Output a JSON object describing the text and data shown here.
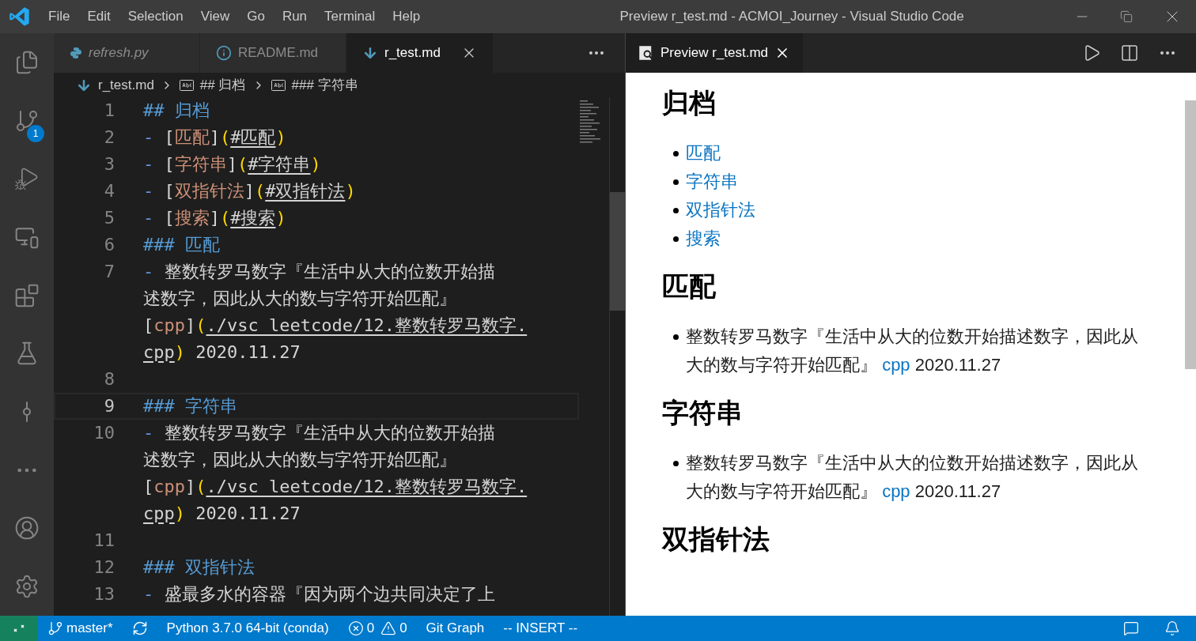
{
  "menu": [
    "File",
    "Edit",
    "Selection",
    "View",
    "Go",
    "Run",
    "Terminal",
    "Help"
  ],
  "window": {
    "title": "Preview r_test.md - ACMOI_Journey - Visual Studio Code"
  },
  "activity_bar": [
    {
      "kind": "files"
    },
    {
      "kind": "source-control",
      "badge": "1"
    },
    {
      "kind": "run"
    },
    {
      "kind": "remote"
    },
    {
      "kind": "extensions"
    },
    {
      "kind": "testing"
    },
    {
      "kind": "graph"
    },
    {
      "kind": "more"
    }
  ],
  "activity_bottom": [
    {
      "kind": "account"
    },
    {
      "kind": "settings"
    }
  ],
  "tabs": [
    {
      "label": "refresh.py",
      "preview": true,
      "selected": false
    },
    {
      "label": "README.md",
      "preview": false,
      "selected": false
    },
    {
      "label": "r_test.md",
      "preview": false,
      "selected": true
    }
  ],
  "breadcrumbs": [
    {
      "label": "r_test.md"
    },
    {
      "label": "## 归档"
    },
    {
      "label": "### 字符串"
    }
  ],
  "code_lines": [
    {
      "number": "1",
      "current": false,
      "tokens": [
        {
          "text": "## 归档",
          "kind": "heading"
        }
      ]
    },
    {
      "number": "2",
      "current": false,
      "tokens": [
        {
          "text": "- ",
          "kind": "bullet"
        },
        {
          "text": "[",
          "kind": "punct"
        },
        {
          "text": "匹配",
          "kind": "linktext"
        },
        {
          "text": "]",
          "kind": "punct"
        },
        {
          "text": "(",
          "kind": "paren"
        },
        {
          "text": "#匹配",
          "kind": "url"
        },
        {
          "text": ")",
          "kind": "paren"
        }
      ]
    },
    {
      "number": "3",
      "current": false,
      "tokens": [
        {
          "text": "- ",
          "kind": "bullet"
        },
        {
          "text": "[",
          "kind": "punct"
        },
        {
          "text": "字符串",
          "kind": "linktext"
        },
        {
          "text": "]",
          "kind": "punct"
        },
        {
          "text": "(",
          "kind": "paren"
        },
        {
          "text": "#字符串",
          "kind": "url"
        },
        {
          "text": ")",
          "kind": "paren"
        }
      ]
    },
    {
      "number": "4",
      "current": false,
      "tokens": [
        {
          "text": "- ",
          "kind": "bullet"
        },
        {
          "text": "[",
          "kind": "punct"
        },
        {
          "text": "双指针法",
          "kind": "linktext"
        },
        {
          "text": "]",
          "kind": "punct"
        },
        {
          "text": "(",
          "kind": "paren"
        },
        {
          "text": "#双指针法",
          "kind": "url"
        },
        {
          "text": ")",
          "kind": "paren"
        }
      ]
    },
    {
      "number": "5",
      "current": false,
      "tokens": [
        {
          "text": "- ",
          "kind": "bullet"
        },
        {
          "text": "[",
          "kind": "punct"
        },
        {
          "text": "搜索",
          "kind": "linktext"
        },
        {
          "text": "]",
          "kind": "punct"
        },
        {
          "text": "(",
          "kind": "paren"
        },
        {
          "text": "#搜索",
          "kind": "url"
        },
        {
          "text": ")",
          "kind": "paren"
        }
      ]
    },
    {
      "number": "6",
      "current": false,
      "tokens": [
        {
          "text": "### 匹配",
          "kind": "heading"
        }
      ]
    },
    {
      "number": "7",
      "current": false,
      "tokens": [
        {
          "text": "- ",
          "kind": "bullet"
        },
        {
          "text": "整数转罗马数字『生活中从大的位数开始描",
          "kind": "text"
        },
        {
          "kind": "wrap"
        },
        {
          "text": "述数字，因此从大的数与字符开始匹配』",
          "kind": "text"
        },
        {
          "kind": "wrap"
        },
        {
          "text": "[",
          "kind": "punct"
        },
        {
          "text": "cpp",
          "kind": "linktext"
        },
        {
          "text": "]",
          "kind": "punct"
        },
        {
          "text": "(",
          "kind": "paren"
        },
        {
          "text": "./vsc_leetcode/12.整数转罗马数字.",
          "kind": "url"
        },
        {
          "kind": "wrap"
        },
        {
          "text": "cpp",
          "kind": "url"
        },
        {
          "text": ")",
          "kind": "paren"
        },
        {
          "text": " 2020.11.27",
          "kind": "text"
        }
      ]
    },
    {
      "number": "8",
      "current": false
    },
    {
      "number": "9",
      "current": true,
      "tokens": [
        {
          "text": "### 字符串",
          "kind": "heading"
        }
      ]
    },
    {
      "number": "10",
      "current": false,
      "tokens": [
        {
          "text": "- ",
          "kind": "bullet"
        },
        {
          "text": "整数转罗马数字『生活中从大的位数开始描",
          "kind": "text"
        },
        {
          "kind": "wrap"
        },
        {
          "text": "述数字，因此从大的数与字符开始匹配』",
          "kind": "text"
        },
        {
          "kind": "wrap"
        },
        {
          "text": "[",
          "kind": "punct"
        },
        {
          "text": "cpp",
          "kind": "linktext"
        },
        {
          "text": "]",
          "kind": "punct"
        },
        {
          "text": "(",
          "kind": "paren"
        },
        {
          "text": "./vsc_leetcode/12.整数转罗马数字.",
          "kind": "url"
        },
        {
          "kind": "wrap"
        },
        {
          "text": "cpp",
          "kind": "url"
        },
        {
          "text": ")",
          "kind": "paren"
        },
        {
          "text": " 2020.11.27",
          "kind": "text"
        }
      ]
    },
    {
      "number": "11",
      "current": false
    },
    {
      "number": "12",
      "current": false,
      "tokens": [
        {
          "text": "### 双指针法",
          "kind": "heading"
        }
      ]
    },
    {
      "number": "13",
      "current": false,
      "tokens": [
        {
          "text": "- ",
          "kind": "bullet"
        },
        {
          "text": "盛最多水的容器『因为两个边共同决定了上",
          "kind": "text"
        }
      ]
    }
  ],
  "preview_tab": {
    "label": "Preview r_test.md"
  },
  "preview": [
    {
      "kind": "heading",
      "text": "归档"
    },
    {
      "kind": "list",
      "items": [
        [
          {
            "text": "匹配",
            "link": true
          }
        ],
        [
          {
            "text": "字符串",
            "link": true
          }
        ],
        [
          {
            "text": "双指针法",
            "link": true
          }
        ],
        [
          {
            "text": "搜索",
            "link": true
          }
        ]
      ]
    },
    {
      "kind": "heading",
      "text": "匹配"
    },
    {
      "kind": "list",
      "items": [
        [
          {
            "text": "整数转罗马数字『生活中从大的位数开始描述数字，因此从大的数与字符开始匹配』 ",
            "link": false
          },
          {
            "text": "cpp",
            "link": true
          },
          {
            "text": " 2020.11.27",
            "link": false
          }
        ]
      ]
    },
    {
      "kind": "heading",
      "text": "字符串"
    },
    {
      "kind": "list",
      "items": [
        [
          {
            "text": "整数转罗马数字『生活中从大的位数开始描述数字，因此从大的数与字符开始匹配』 ",
            "link": false
          },
          {
            "text": "cpp",
            "link": true
          },
          {
            "text": " 2020.11.27",
            "link": false
          }
        ]
      ]
    },
    {
      "kind": "heading",
      "text": "双指针法"
    }
  ],
  "status_bar": {
    "branch": "master*",
    "python": "Python 3.7.0 64-bit (conda)",
    "errors": "0",
    "warnings": "0",
    "git_graph": "Git Graph",
    "mode": "-- INSERT --"
  }
}
